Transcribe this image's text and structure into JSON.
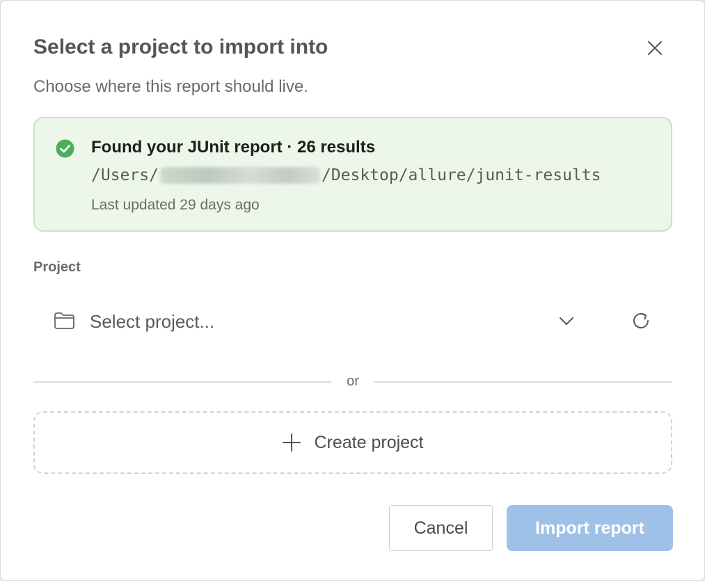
{
  "dialog": {
    "title": "Select a project to import into",
    "subtitle": "Choose where this report should live.",
    "close_icon": "close-icon"
  },
  "notice": {
    "status_icon": "check-circle-icon",
    "heading": "Found your JUnit report · 26 results",
    "path_prefix": "/Users/",
    "path_suffix": "/Desktop/allure/junit-results",
    "updated": "Last updated 29 days ago",
    "colors": {
      "background": "#ecf7ea",
      "border": "#c6e4c1",
      "icon": "#4cae5c"
    }
  },
  "project": {
    "label": "Project",
    "placeholder": "Select project...",
    "folder_icon": "folder-icon",
    "dropdown_icon": "chevron-down-icon",
    "refresh_icon": "refresh-icon"
  },
  "divider": {
    "text": "or"
  },
  "create": {
    "label": "Create project",
    "icon": "plus-icon"
  },
  "actions": {
    "cancel": "Cancel",
    "import": "Import report",
    "import_color": "#9fc1e7"
  }
}
